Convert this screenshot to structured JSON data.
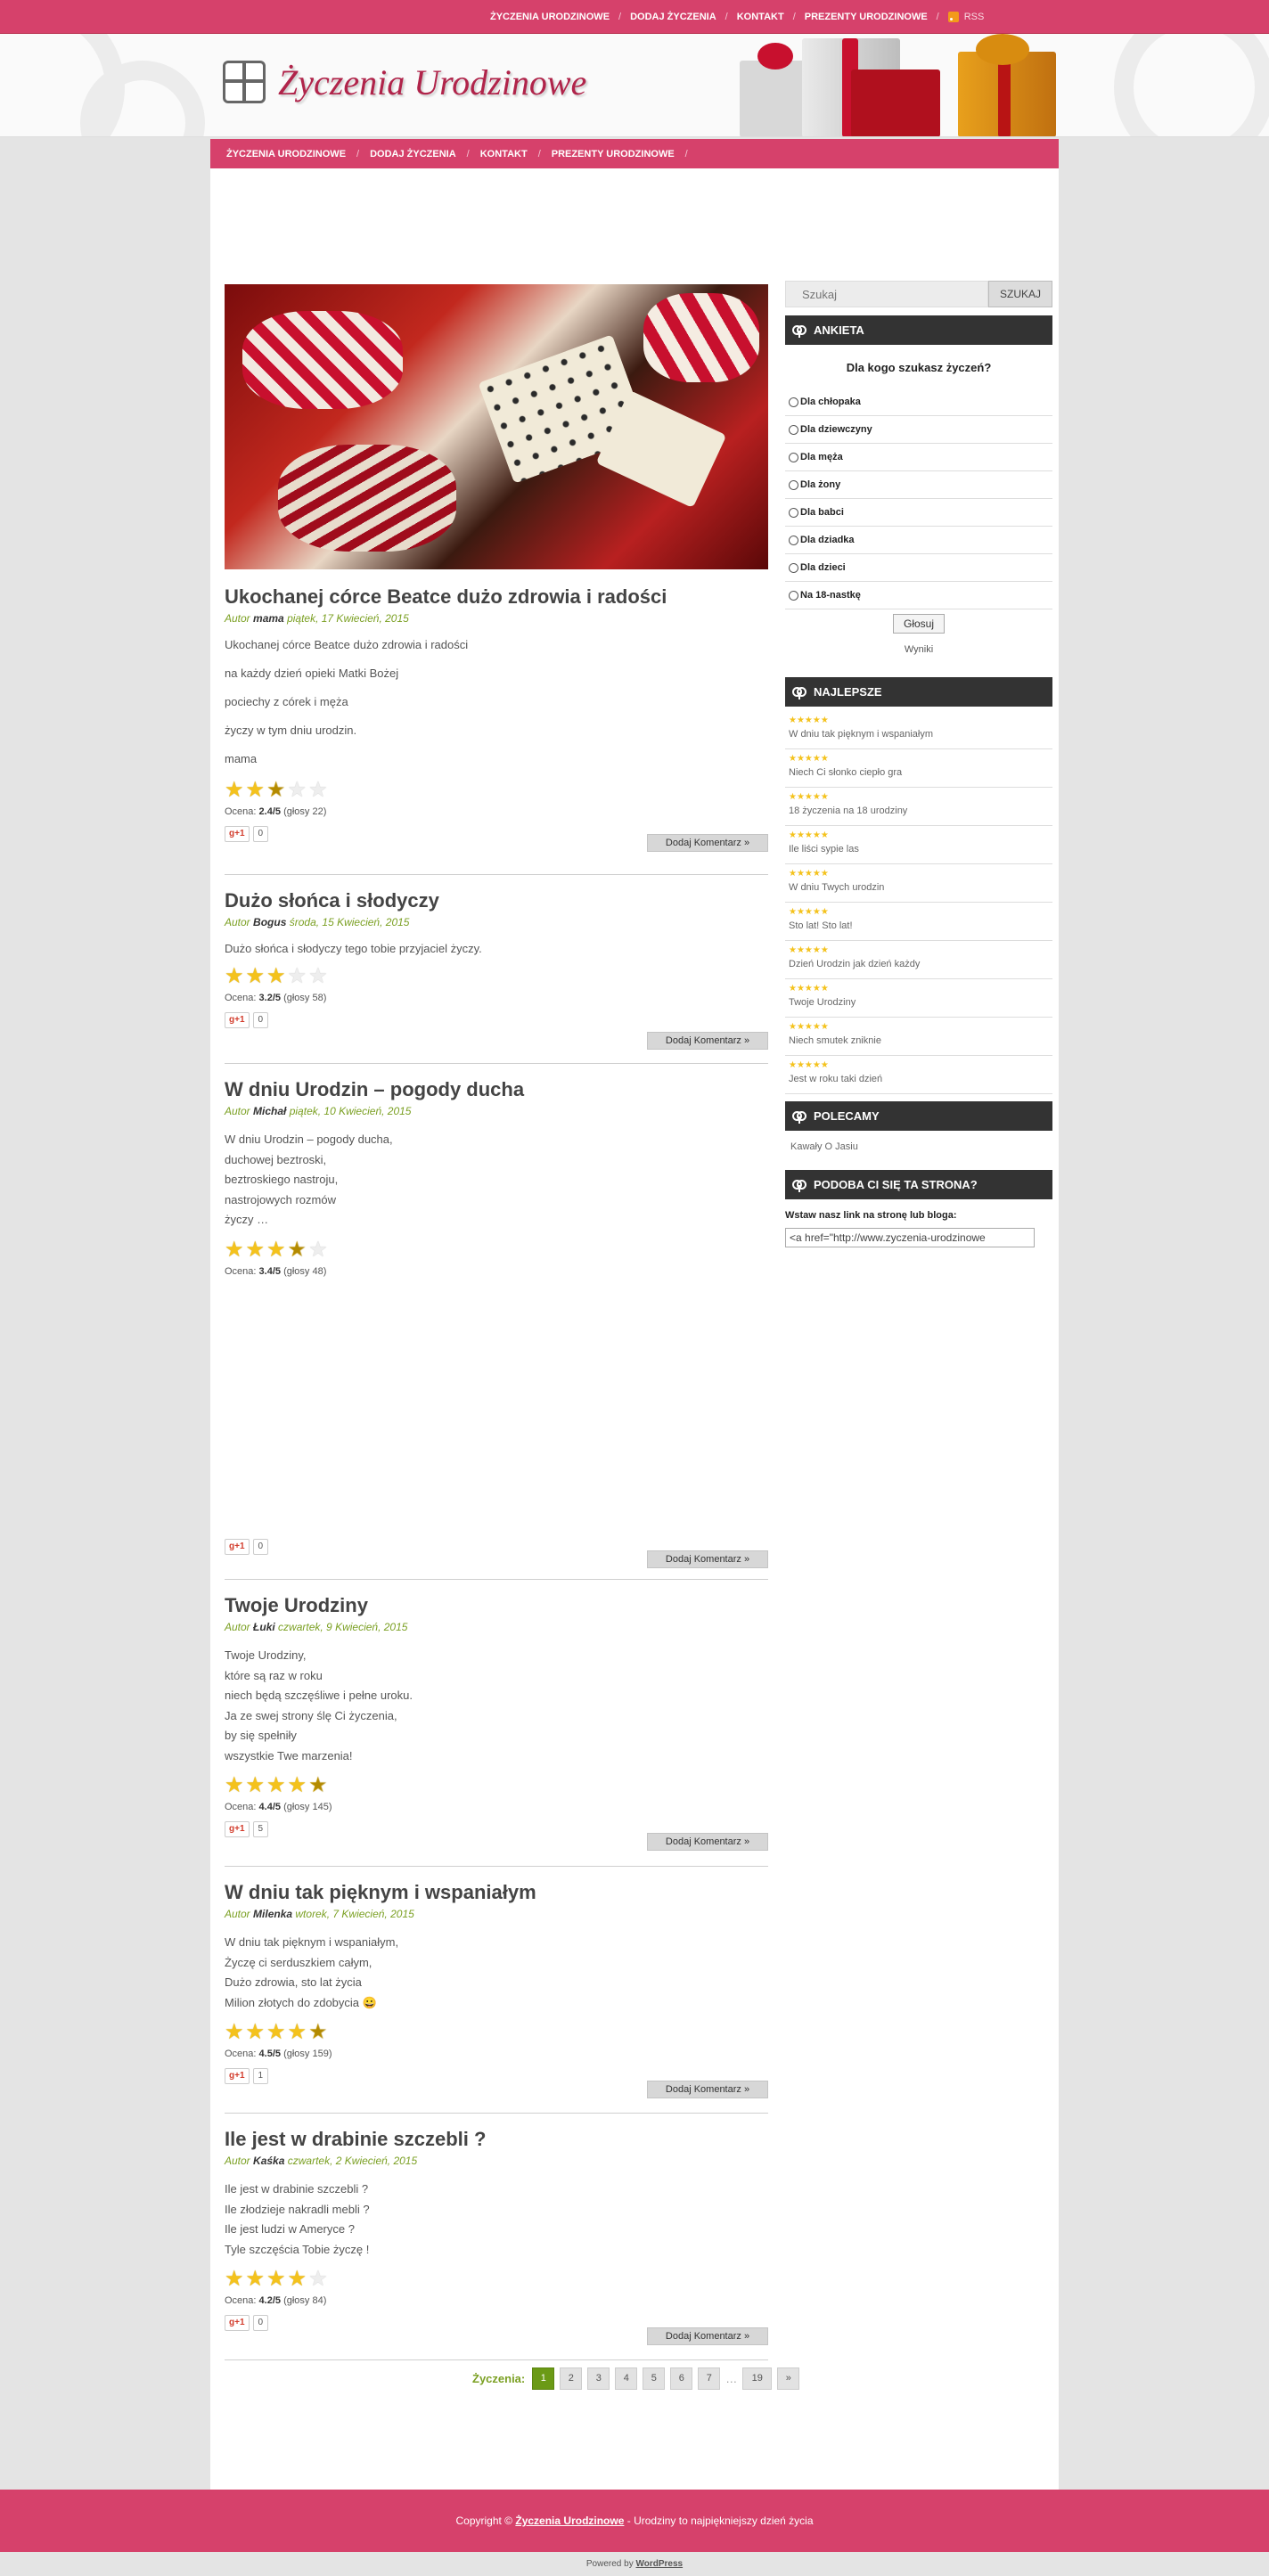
{
  "topnav": {
    "items": [
      "Życzenia urodzinowe",
      "Dodaj życzenia",
      "Kontakt",
      "Prezenty urodzinowe"
    ],
    "rss": "RSS"
  },
  "header": {
    "logo": "Życzenia Urodzinowe"
  },
  "mainnav": {
    "items": [
      "Życzenia urodzinowe",
      "Dodaj życzenia",
      "Kontakt",
      "Prezenty urodzinowe"
    ]
  },
  "comment_label": "Dodaj Komentarz »",
  "posts": [
    {
      "title": "Ukochanej córce Beatce dużo zdrowia i radości",
      "meta_prefix": "Autor",
      "author": "mama",
      "date": "piątek, 17 Kwiecień, 2015",
      "paragraphs": [
        "Ukochanej córce Beatce dużo zdrowia i radości",
        "na każdy dzień opieki Matki Bożej",
        "pociechy z córek i męża",
        "życzy w tym dniu urodzin.",
        "mama"
      ],
      "rating": 2.4,
      "rating_text": "Ocena:",
      "rating_value": "2.4/5",
      "votes": "(głosy 22)",
      "gplus": "g+1",
      "gcount": "0"
    },
    {
      "title": "Dużo słońca i słodyczy",
      "meta_prefix": "Autor",
      "author": "Bogus",
      "date": "środa, 15 Kwiecień, 2015",
      "paragraphs": [
        "Dużo słońca i słodyczy tego tobie przyjaciel życzy."
      ],
      "rating": 3.2,
      "rating_text": "Ocena:",
      "rating_value": "3.2/5",
      "votes": "(głosy 58)",
      "gplus": "g+1",
      "gcount": "0"
    },
    {
      "title": "W dniu Urodzin – pogody ducha",
      "meta_prefix": "Autor",
      "author": "Michał",
      "date": "piątek, 10 Kwiecień, 2015",
      "lines": [
        "W dniu Urodzin – pogody ducha,",
        "duchowej beztroski,",
        "beztroskiego nastroju,",
        "nastrojowych rozmów",
        "życzy …"
      ],
      "rating": 3.4,
      "rating_text": "Ocena:",
      "rating_value": "3.4/5",
      "votes": "(głosy 48)",
      "gplus": "g+1",
      "gcount": "0"
    },
    {
      "title": "Twoje Urodziny",
      "meta_prefix": "Autor",
      "author": "Łuki",
      "date": "czwartek, 9 Kwiecień, 2015",
      "lines": [
        "Twoje Urodziny,",
        "które są raz w roku",
        "niech będą szczęśliwe i pełne uroku.",
        "Ja ze swej strony ślę Ci życzenia,",
        "by się spełniły",
        "wszystkie Twe marzenia!"
      ],
      "rating": 4.4,
      "rating_text": "Ocena:",
      "rating_value": "4.4/5",
      "votes": "(głosy 145)",
      "gplus": "g+1",
      "gcount": "5"
    },
    {
      "title": "W dniu tak pięknym i wspaniałym",
      "meta_prefix": "Autor",
      "author": "Milenka",
      "date": "wtorek, 7 Kwiecień, 2015",
      "lines": [
        "W dniu tak pięknym i wspaniałym,",
        "Życzę ci serduszkiem całym,",
        "Dużo zdrowia, sto lat życia",
        "Milion złotych do zdobycia 😀"
      ],
      "rating": 4.5,
      "rating_text": "Ocena:",
      "rating_value": "4.5/5",
      "votes": "(głosy 159)",
      "gplus": "g+1",
      "gcount": "1"
    },
    {
      "title": "Ile jest w drabinie szczebli ?",
      "meta_prefix": "Autor",
      "author": "Kaśka",
      "date": "czwartek, 2 Kwiecień, 2015",
      "lines": [
        "Ile jest w drabinie szczebli ?",
        "Ile złodzieje nakradli mebli ?",
        "Ile jest ludzi w Ameryce ?",
        "Tyle szczęścia Tobie życzę !"
      ],
      "rating": 4.2,
      "rating_text": "Ocena:",
      "rating_value": "4.2/5",
      "votes": "(głosy 84)",
      "gplus": "g+1",
      "gcount": "0"
    }
  ],
  "pagination": {
    "label": "Życzenia:",
    "pages": [
      "1",
      "2",
      "3",
      "4",
      "5",
      "6",
      "7"
    ],
    "dots": "…",
    "last": "19",
    "next": "»"
  },
  "sidebar": {
    "search": {
      "placeholder": "Szukaj",
      "button": "SZUKAJ"
    },
    "poll": {
      "title": "Ankieta",
      "question": "Dla kogo szukasz życzeń?",
      "options": [
        "Dla chłopaka",
        "Dla dziewczyny",
        "Dla męża",
        "Dla żony",
        "Dla babci",
        "Dla dziadka",
        "Dla dzieci",
        "Na 18-nastkę"
      ],
      "vote": "Głosuj",
      "results": "Wyniki"
    },
    "best": {
      "title": "Najlepsze",
      "items": [
        "W dniu tak pięknym i wspaniałym",
        "Niech Ci słonko ciepło gra",
        "18 życzenia na 18 urodziny",
        "Ile liści sypie las",
        "W dniu Twych urodzin",
        "Sto lat! Sto lat!",
        "Dzień Urodzin jak dzień każdy",
        "Twoje Urodziny",
        "Niech smutek zniknie",
        "Jest w roku taki dzień"
      ]
    },
    "polecamy": {
      "title": "Polecamy",
      "link": "Kawały O Jasiu"
    },
    "share": {
      "title": "Podoba ci się ta strona?",
      "label": "Wstaw nasz link na stronę lub bloga:",
      "value": "<a href=\"http://www.zyczenia-urodzinowe"
    }
  },
  "footer": {
    "prefix": "Copyright ©",
    "site": "Życzenia Urodzinowe",
    "suffix": "- Urodziny to najpiękniejszy dzień życia"
  },
  "powered": {
    "prefix": "Powered by",
    "name": "WordPress"
  },
  "colors": {
    "pink": "#d6416b",
    "green": "#7ba023",
    "dark": "#333333"
  }
}
